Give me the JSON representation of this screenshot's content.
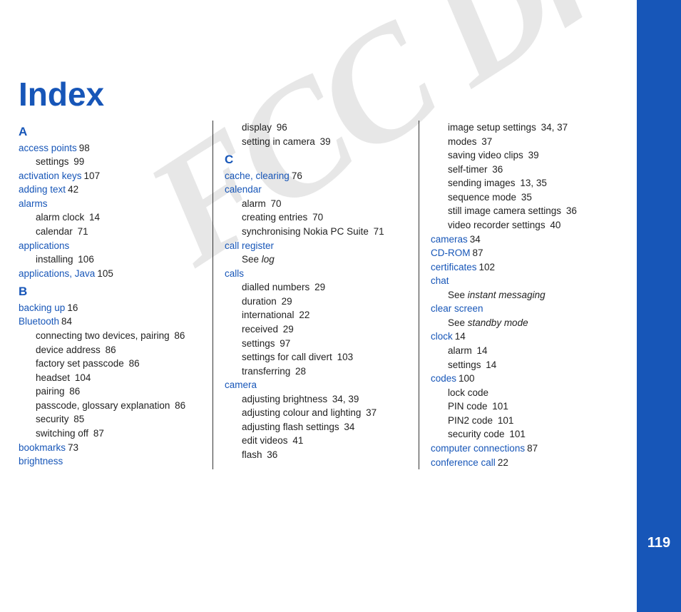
{
  "page_number": "119",
  "watermark": "FCC Draft",
  "title": "Index",
  "columns": {
    "col1": {
      "letterA": "A",
      "access_points": "access points",
      "access_points_p": "98",
      "access_points_settings": "settings",
      "access_points_settings_p": "99",
      "activation_keys": "activation keys",
      "activation_keys_p": "107",
      "adding_text": "adding text",
      "adding_text_p": "42",
      "alarms": "alarms",
      "alarms_clock": "alarm clock",
      "alarms_clock_p": "14",
      "alarms_calendar": "calendar",
      "alarms_calendar_p": "71",
      "applications": "applications",
      "applications_installing": "installing",
      "applications_installing_p": "106",
      "applications_java": "applications, Java",
      "applications_java_p": "105",
      "letterB": "B",
      "backing_up": "backing up",
      "backing_up_p": "16",
      "bluetooth": "Bluetooth",
      "bluetooth_p": "84",
      "bt_connecting": "connecting two devices, pairing",
      "bt_connecting_p": "86",
      "bt_device_addr": "device address",
      "bt_device_addr_p": "86",
      "bt_factory": "factory set passcode",
      "bt_factory_p": "86",
      "bt_headset": "headset",
      "bt_headset_p": "104",
      "bt_pairing": "pairing",
      "bt_pairing_p": "86",
      "bt_passcode": "passcode, glossary explanation",
      "bt_passcode_p": "86",
      "bt_security": "security",
      "bt_security_p": "85",
      "bt_switchoff": "switching off",
      "bt_switchoff_p": "87",
      "bookmarks": "bookmarks",
      "bookmarks_p": "73",
      "brightness": "brightness"
    },
    "col2": {
      "br_display": "display",
      "br_display_p": "96",
      "br_setting": "setting in camera",
      "br_setting_p": "39",
      "letterC": "C",
      "cache": "cache, clearing",
      "cache_p": "76",
      "calendar": "calendar",
      "cal_alarm": "alarm",
      "cal_alarm_p": "70",
      "cal_create": "creating entries",
      "cal_create_p": "70",
      "cal_sync": "synchronising Nokia PC Suite",
      "cal_sync_p": "71",
      "call_register": "call register",
      "call_register_see": "See ",
      "call_register_see_i": "log",
      "calls": "calls",
      "calls_dialled": "dialled numbers",
      "calls_dialled_p": "29",
      "calls_duration": "duration",
      "calls_duration_p": "29",
      "calls_intl": "international",
      "calls_intl_p": "22",
      "calls_received": "received",
      "calls_received_p": "29",
      "calls_settings": "settings",
      "calls_settings_p": "97",
      "calls_divert": "settings for call divert",
      "calls_divert_p": "103",
      "calls_transfer": "transferring",
      "calls_transfer_p": "28",
      "camera": "camera",
      "cam_brightness": "adjusting brightness",
      "cam_brightness_p": "34, 39",
      "cam_colour": "adjusting colour and lighting",
      "cam_colour_p": "37",
      "cam_flash": "adjusting flash settings",
      "cam_flash_p": "34",
      "cam_edit": "edit videos",
      "cam_edit_p": "41",
      "cam_flash2": "flash",
      "cam_flash2_p": "36"
    },
    "col3": {
      "cam_image_setup": "image setup settings",
      "cam_image_setup_p": "34, 37",
      "cam_modes": "modes",
      "cam_modes_p": "37",
      "cam_saving": "saving video clips",
      "cam_saving_p": "39",
      "cam_selftimer": "self-timer",
      "cam_selftimer_p": "36",
      "cam_sending": "sending images",
      "cam_sending_p": "13, 35",
      "cam_sequence": "sequence mode",
      "cam_sequence_p": "35",
      "cam_still": "still image camera settings",
      "cam_still_p": "36",
      "cam_video": "video recorder settings",
      "cam_video_p": "40",
      "cameras": "cameras",
      "cameras_p": "34",
      "cdrom": "CD-ROM",
      "cdrom_p": "87",
      "certificates": "certificates",
      "certificates_p": "102",
      "chat": "chat",
      "chat_see": "See ",
      "chat_see_i": "instant messaging",
      "clear_screen": "clear screen",
      "clear_see": "See ",
      "clear_see_i": "standby mode",
      "clock": "clock",
      "clock_p": "14",
      "clock_alarm": "alarm",
      "clock_alarm_p": "14",
      "clock_settings": "settings",
      "clock_settings_p": "14",
      "codes": "codes",
      "codes_p": "100",
      "codes_lock": "lock code",
      "codes_pin": "PIN code",
      "codes_pin_p": "101",
      "codes_pin2": "PIN2 code",
      "codes_pin2_p": "101",
      "codes_security": "security code",
      "codes_security_p": "101",
      "comp_conn": "computer connections",
      "comp_conn_p": "87",
      "conf_call": "conference call",
      "conf_call_p": "22"
    }
  }
}
